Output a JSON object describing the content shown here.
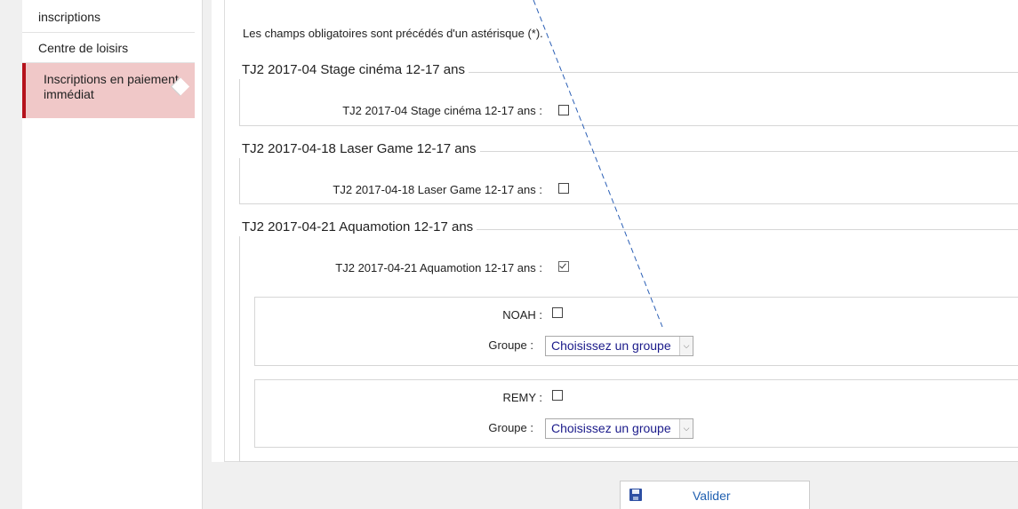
{
  "sidebar": {
    "items": [
      {
        "label": "inscriptions"
      },
      {
        "label": "Centre de loisirs"
      },
      {
        "label": "Inscriptions en paiement immédiat"
      }
    ]
  },
  "main": {
    "notice": "Les champs obligatoires sont précédés d'un astérisque (*).",
    "sections": [
      {
        "legend": "TJ2 2017-04 Stage cinéma 12-17 ans",
        "field_label": "TJ2 2017-04 Stage cinéma 12-17 ans :",
        "checked": false
      },
      {
        "legend": "TJ2 2017-04-18 Laser Game 12-17 ans",
        "field_label": "TJ2 2017-04-18 Laser Game 12-17 ans :",
        "checked": false
      },
      {
        "legend": "TJ2 2017-04-21 Aquamotion 12-17 ans",
        "field_label": "TJ2 2017-04-21 Aquamotion 12-17 ans :",
        "checked": true
      }
    ],
    "participants": [
      {
        "name_label": "NOAH :",
        "checked": false,
        "group_label": "Groupe :",
        "group_value": "Choisissez un groupe"
      },
      {
        "name_label": "REMY :",
        "checked": false,
        "group_label": "Groupe :",
        "group_value": "Choisissez un groupe"
      }
    ]
  },
  "actions": {
    "submit_label": "Valider",
    "submit_icon": "floppy-disk-icon"
  },
  "colors": {
    "active_bg": "#f0c8c8",
    "active_border": "#b5121b",
    "link_blue": "#1f5fb0",
    "select_text": "#1a1a8a"
  }
}
